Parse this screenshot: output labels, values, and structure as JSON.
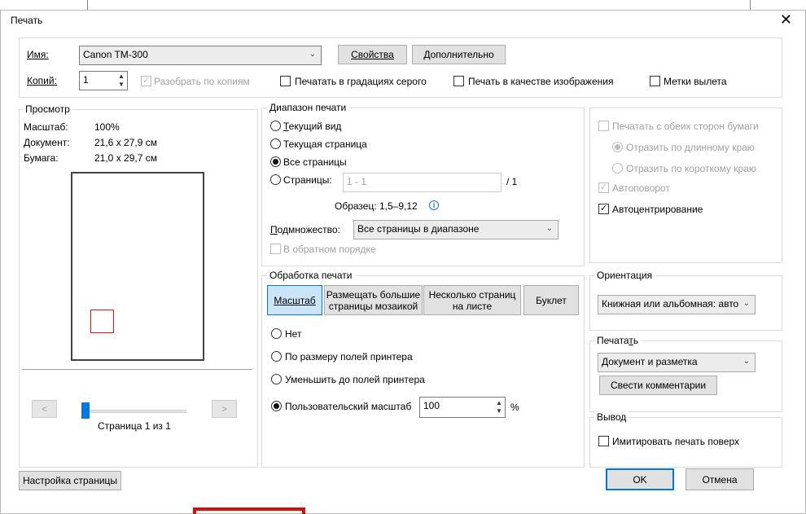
{
  "window": {
    "title": "Печать"
  },
  "printer": {
    "name_label": "Имя:",
    "name_value": "Canon TM-300",
    "properties_button": "Свойства",
    "advanced_button": "Дополнительно",
    "copies_label": "Копий:",
    "copies_value": "1",
    "collate_label": "Разобрать по копиям",
    "grayscale_label": "Печатать в градациях серого",
    "as_image_label": "Печать в качестве изображения",
    "bleed_marks_label": "Метки вылета"
  },
  "preview": {
    "title": "Просмотр",
    "scale_label": "Масштаб:",
    "scale_value": "100%",
    "document_label": "Документ:",
    "document_value": "21,6 x 27,9 см",
    "paper_label": "Бумага:",
    "paper_value": "21,0 x 29,7 см",
    "prev_glyph": "<",
    "next_glyph": ">",
    "page_indicator": "Страница 1 из 1",
    "page_current": 1,
    "page_total": 1
  },
  "range": {
    "title": "Диапазон печати",
    "current_view": "Текущий вид",
    "current_page": "Текущая страница",
    "all_pages": "Все страницы",
    "pages_label": "Страницы:",
    "pages_value": "1 - 1",
    "pages_total": "/ 1",
    "sample": "Образец: 1,5–9,12",
    "subset_label": "Подмножество:",
    "subset_value": "Все страницы в диапазоне",
    "reverse_label": "В обратном порядке"
  },
  "handling": {
    "title": "Обработка печати",
    "tab_scale": "Масштаб",
    "tab_poster_line1": "Размещать большие",
    "tab_poster_line2": "страницы мозаикой",
    "tab_multiple_line1": "Несколько страниц",
    "tab_multiple_line2": "на листе",
    "tab_booklet": "Буклет",
    "opt_none": "Нет",
    "opt_fit": "По размеру полей принтера",
    "opt_shrink": "Уменьшить до полей принтера",
    "opt_custom": "Пользовательский масштаб",
    "custom_value": "100",
    "percent": "%"
  },
  "duplex": {
    "both_sides": "Печатать с обеих сторон бумаги",
    "flip_long": "Отразить по длинному краю",
    "flip_short": "Отразить по короткому краю",
    "auto_rotate": "Автоповорот",
    "auto_center": "Автоцентрирование"
  },
  "orientation": {
    "title": "Ориентация",
    "value": "Книжная или альбомная: авто"
  },
  "print_what": {
    "title": "Печатать",
    "value": "Документ и разметка",
    "summarize_button": "Свести комментарии"
  },
  "output": {
    "title": "Вывод",
    "simulate_overprint": "Имитировать печать поверх"
  },
  "footer": {
    "page_setup_button": "Настройка страницы",
    "ok_button": "OK",
    "cancel_button": "Отмена"
  },
  "icons": {
    "close": "close-icon",
    "dropdown": "chevron-down-icon",
    "info": "info-icon",
    "check": "check-icon"
  },
  "colors": {
    "accent": "#0078d7",
    "selected_tab_bg": "#cce4f7",
    "preview_marker": "#e01010"
  }
}
